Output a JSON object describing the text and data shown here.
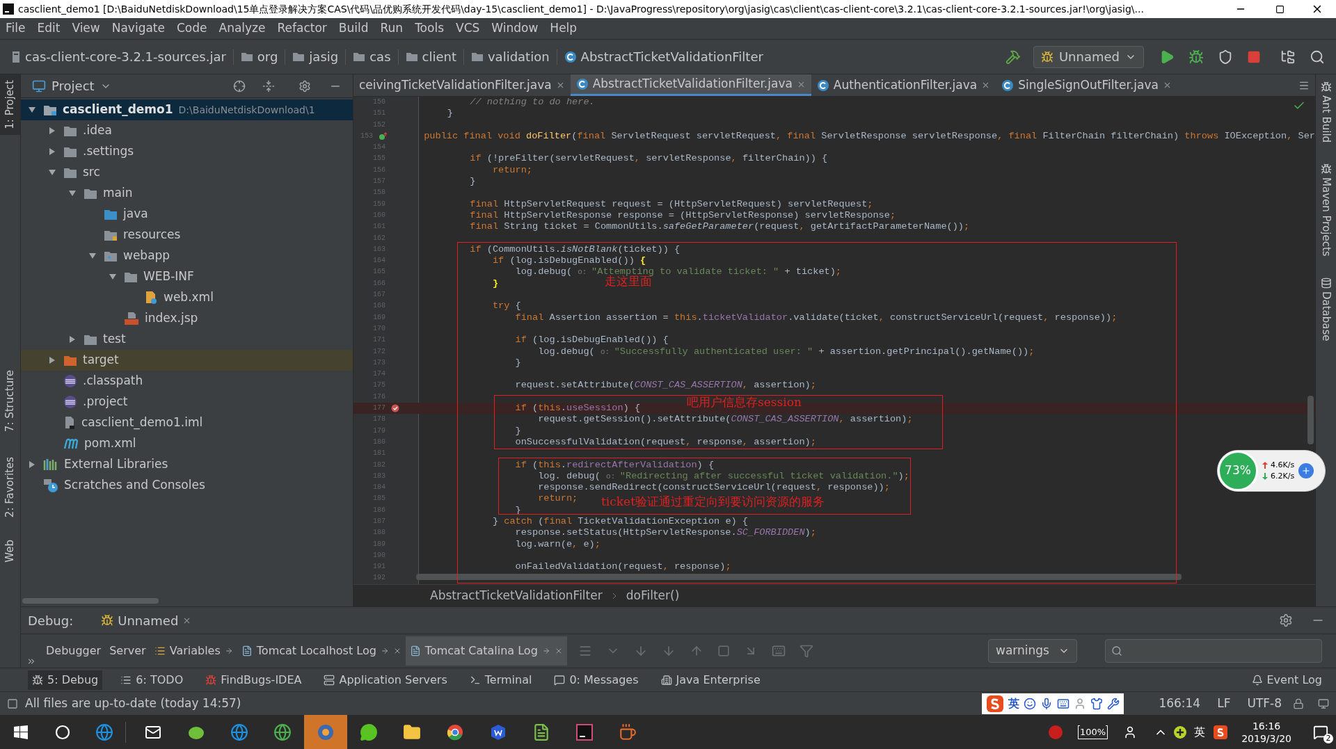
{
  "window": {
    "title": "casclient_demo1 [D:\\BaiduNetdiskDownload\\15单点登录解决方案CAS\\代码\\品优购系统开发代码\\day-15\\casclient_demo1] - D:\\JavaProgress\\repository\\org\\jasig\\cas\\client\\cas-client-core\\3.2.1\\cas-client-core-3.2.1-sources.jar!\\org\\jasig\\..."
  },
  "menu": [
    "File",
    "Edit",
    "View",
    "Navigate",
    "Code",
    "Analyze",
    "Refactor",
    "Build",
    "Run",
    "Tools",
    "VCS",
    "Window",
    "Help"
  ],
  "navbar": {
    "crumbs": [
      {
        "label": "cas-client-core-3.2.1-sources.jar",
        "kind": "jar"
      },
      {
        "label": "org",
        "kind": "folder"
      },
      {
        "label": "jasig",
        "kind": "folder"
      },
      {
        "label": "cas",
        "kind": "folder"
      },
      {
        "label": "client",
        "kind": "folder"
      },
      {
        "label": "validation",
        "kind": "folder"
      },
      {
        "label": "AbstractTicketValidationFilter",
        "kind": "class"
      }
    ],
    "run_config": "Unnamed"
  },
  "left_strip": [
    {
      "label": "1: Project",
      "selected": true
    },
    {
      "label": "7: Structure",
      "selected": false
    },
    {
      "label": "2: Favorites",
      "selected": false
    },
    {
      "label": "Web",
      "selected": false
    }
  ],
  "right_strip": [
    "Ant Build",
    "Maven Projects",
    "Database"
  ],
  "project": {
    "title": "Project",
    "tree": [
      {
        "label": "casclient_demo1",
        "path": "D:\\BaiduNetdiskDownload\\1",
        "kind": "module",
        "expanded": true,
        "selected": true,
        "highlighted": false,
        "children": [
          {
            "label": ".idea",
            "kind": "folder",
            "expanded": false,
            "selected": false,
            "highlighted": false
          },
          {
            "label": ".settings",
            "kind": "folder",
            "expanded": false,
            "selected": false,
            "highlighted": false
          },
          {
            "label": "src",
            "kind": "folder",
            "expanded": true,
            "selected": false,
            "highlighted": false,
            "children": [
              {
                "label": "main",
                "kind": "folder",
                "expanded": true,
                "selected": false,
                "highlighted": false,
                "children": [
                  {
                    "label": "java",
                    "kind": "source",
                    "selected": false,
                    "highlighted": false
                  },
                  {
                    "label": "resources",
                    "kind": "resources",
                    "selected": false,
                    "highlighted": false
                  },
                  {
                    "label": "webapp",
                    "kind": "web",
                    "expanded": true,
                    "selected": false,
                    "highlighted": false,
                    "children": [
                      {
                        "label": "WEB-INF",
                        "kind": "folder",
                        "expanded": true,
                        "selected": false,
                        "highlighted": false,
                        "children": [
                          {
                            "label": "web.xml",
                            "kind": "xml",
                            "selected": false,
                            "highlighted": false
                          }
                        ]
                      },
                      {
                        "label": "index.jsp",
                        "kind": "jsp",
                        "selected": false,
                        "highlighted": false
                      }
                    ]
                  }
                ]
              },
              {
                "label": "test",
                "kind": "folder",
                "expanded": false,
                "selected": false,
                "highlighted": false
              }
            ]
          },
          {
            "label": "target",
            "kind": "excluded",
            "expanded": false,
            "selected": false,
            "highlighted": true
          },
          {
            "label": ".classpath",
            "kind": "eclipse",
            "selected": false,
            "highlighted": false
          },
          {
            "label": ".project",
            "kind": "eclipse",
            "selected": false,
            "highlighted": false
          },
          {
            "label": "casclient_demo1.iml",
            "kind": "iml",
            "selected": false,
            "highlighted": false
          },
          {
            "label": "pom.xml",
            "kind": "maven",
            "selected": false,
            "highlighted": false
          }
        ]
      },
      {
        "label": "External Libraries",
        "kind": "libraries",
        "expanded": false,
        "selected": false,
        "highlighted": false
      },
      {
        "label": "Scratches and Consoles",
        "kind": "scratches",
        "selected": false,
        "highlighted": false
      }
    ]
  },
  "editor": {
    "tabs": [
      {
        "label": "ceivingTicketValidationFilter.java",
        "selected": false
      },
      {
        "label": "AbstractTicketValidationFilter.java",
        "selected": true
      },
      {
        "label": "AuthenticationFilter.java",
        "selected": false
      },
      {
        "label": "SingleSignOutFilter.java",
        "selected": false
      }
    ],
    "lines": [
      {
        "number": "150",
        "kind": "plain",
        "code": [
          {
            "kind": "comment",
            "text": "        // nothing to do here."
          }
        ]
      },
      {
        "number": "151",
        "kind": "plain",
        "code": [
          {
            "kind": "plain",
            "text": "    }"
          }
        ]
      },
      {
        "number": "152",
        "kind": "plain"
      },
      {
        "number": "153",
        "kind": "override",
        "code": [
          {
            "kind": "keyword",
            "text": "    public final void "
          },
          {
            "kind": "method",
            "text": "doFilter"
          },
          {
            "kind": "plain",
            "text": "("
          },
          {
            "kind": "keyword",
            "text": "final "
          },
          {
            "kind": "plain",
            "text": "ServletRequest servletRequest"
          },
          {
            "kind": "keyword",
            "text": ", final "
          },
          {
            "kind": "plain",
            "text": "ServletResponse servletResponse"
          },
          {
            "kind": "keyword",
            "text": ", final "
          },
          {
            "kind": "plain",
            "text": "FilterChain filterChain) "
          },
          {
            "kind": "keyword",
            "text": "throws "
          },
          {
            "kind": "plain",
            "text": "IOException"
          },
          {
            "kind": "keyword",
            "text": ", "
          },
          {
            "kind": "plain",
            "text": "Ser"
          }
        ]
      },
      {
        "number": "154",
        "kind": "plain"
      },
      {
        "number": "155",
        "kind": "plain",
        "code": [
          {
            "kind": "keyword",
            "text": "        if "
          },
          {
            "kind": "plain",
            "text": "(!preFilter(servletRequest"
          },
          {
            "kind": "keyword",
            "text": ", "
          },
          {
            "kind": "plain",
            "text": "servletResponse"
          },
          {
            "kind": "keyword",
            "text": ", "
          },
          {
            "kind": "plain",
            "text": "filterChain)) {"
          }
        ]
      },
      {
        "number": "156",
        "kind": "plain",
        "code": [
          {
            "kind": "keyword",
            "text": "            return;"
          }
        ]
      },
      {
        "number": "157",
        "kind": "plain",
        "code": [
          {
            "kind": "plain",
            "text": "        }"
          }
        ]
      },
      {
        "number": "158",
        "kind": "plain"
      },
      {
        "number": "159",
        "kind": "plain",
        "code": [
          {
            "kind": "keyword",
            "text": "        final "
          },
          {
            "kind": "plain",
            "text": "HttpServletRequest request = (HttpServletRequest) servletRequest"
          },
          {
            "kind": "keyword",
            "text": ";"
          }
        ]
      },
      {
        "number": "160",
        "kind": "plain",
        "code": [
          {
            "kind": "keyword",
            "text": "        final "
          },
          {
            "kind": "plain",
            "text": "HttpServletResponse response = (HttpServletResponse) servletResponse"
          },
          {
            "kind": "keyword",
            "text": ";"
          }
        ]
      },
      {
        "number": "161",
        "kind": "plain",
        "code": [
          {
            "kind": "keyword",
            "text": "        final "
          },
          {
            "kind": "plain",
            "text": "String ticket = CommonUtils."
          },
          {
            "kind": "static",
            "text": "safeGetParameter"
          },
          {
            "kind": "plain",
            "text": "(request"
          },
          {
            "kind": "keyword",
            "text": ", "
          },
          {
            "kind": "plain",
            "text": "getArtifactParameterName())"
          },
          {
            "kind": "keyword",
            "text": ";"
          }
        ]
      },
      {
        "number": "162",
        "kind": "plain"
      },
      {
        "number": "163",
        "kind": "plain",
        "code": [
          {
            "kind": "keyword",
            "text": "        if "
          },
          {
            "kind": "plain",
            "text": "(CommonUtils."
          },
          {
            "kind": "static",
            "text": "isNotBlank"
          },
          {
            "kind": "plain",
            "text": "(ticket)) {"
          }
        ]
      },
      {
        "number": "164",
        "kind": "plain",
        "code": [
          {
            "kind": "keyword",
            "text": "            if "
          },
          {
            "kind": "plain",
            "text": "(log.isDebugEnabled()) "
          },
          {
            "kind": "brace",
            "text": "{"
          }
        ]
      },
      {
        "number": "165",
        "kind": "plain",
        "code": [
          {
            "kind": "plain",
            "text": "                log.debug( "
          },
          {
            "kind": "hint",
            "text": "o: "
          },
          {
            "kind": "string",
            "text": "\"Attempting to validate ticket: \""
          },
          {
            "kind": "plain",
            "text": " + ticket)"
          },
          {
            "kind": "keyword",
            "text": ";"
          }
        ]
      },
      {
        "number": "166",
        "kind": "plain",
        "code": [
          {
            "kind": "brace",
            "text": "            }"
          }
        ]
      },
      {
        "number": "167",
        "kind": "plain"
      },
      {
        "number": "168",
        "kind": "plain",
        "code": [
          {
            "kind": "keyword",
            "text": "            try "
          },
          {
            "kind": "plain",
            "text": "{"
          }
        ]
      },
      {
        "number": "169",
        "kind": "plain",
        "code": [
          {
            "kind": "keyword",
            "text": "                final "
          },
          {
            "kind": "plain",
            "text": "Assertion assertion = "
          },
          {
            "kind": "keyword",
            "text": "this"
          },
          {
            "kind": "plain",
            "text": "."
          },
          {
            "kind": "field",
            "text": "ticketValidator"
          },
          {
            "kind": "plain",
            "text": ".validate(ticket"
          },
          {
            "kind": "keyword",
            "text": ", "
          },
          {
            "kind": "plain",
            "text": "constructServiceUrl(request"
          },
          {
            "kind": "keyword",
            "text": ", "
          },
          {
            "kind": "plain",
            "text": "response))"
          },
          {
            "kind": "keyword",
            "text": ";"
          }
        ]
      },
      {
        "number": "170",
        "kind": "plain"
      },
      {
        "number": "171",
        "kind": "plain",
        "code": [
          {
            "kind": "keyword",
            "text": "                if "
          },
          {
            "kind": "plain",
            "text": "(log.isDebugEnabled()) {"
          }
        ]
      },
      {
        "number": "172",
        "kind": "plain",
        "code": [
          {
            "kind": "plain",
            "text": "                    log.debug( "
          },
          {
            "kind": "hint",
            "text": "o: "
          },
          {
            "kind": "string",
            "text": "\"Successfully authenticated user: \""
          },
          {
            "kind": "plain",
            "text": " + assertion.getPrincipal().getName())"
          },
          {
            "kind": "keyword",
            "text": ";"
          }
        ]
      },
      {
        "number": "173",
        "kind": "plain",
        "code": [
          {
            "kind": "plain",
            "text": "                }"
          }
        ]
      },
      {
        "number": "174",
        "kind": "plain"
      },
      {
        "number": "175",
        "kind": "plain",
        "code": [
          {
            "kind": "plain",
            "text": "                request.setAttribute("
          },
          {
            "kind": "constant",
            "text": "CONST_CAS_ASSERTION"
          },
          {
            "kind": "keyword",
            "text": ", "
          },
          {
            "kind": "plain",
            "text": "assertion)"
          },
          {
            "kind": "keyword",
            "text": ";"
          }
        ]
      },
      {
        "number": "176",
        "kind": "plain"
      },
      {
        "number": "177",
        "kind": "breakpoint",
        "code": [
          {
            "kind": "keyword",
            "text": "                if "
          },
          {
            "kind": "plain",
            "text": "("
          },
          {
            "kind": "keyword",
            "text": "this"
          },
          {
            "kind": "plain",
            "text": "."
          },
          {
            "kind": "field",
            "text": "useSession"
          },
          {
            "kind": "plain",
            "text": ") {"
          }
        ]
      },
      {
        "number": "178",
        "kind": "plain",
        "code": [
          {
            "kind": "plain",
            "text": "                    request.getSession().setAttribute("
          },
          {
            "kind": "constant",
            "text": "CONST_CAS_ASSERTION"
          },
          {
            "kind": "keyword",
            "text": ", "
          },
          {
            "kind": "plain",
            "text": "assertion)"
          },
          {
            "kind": "keyword",
            "text": ";"
          }
        ]
      },
      {
        "number": "179",
        "kind": "plain",
        "code": [
          {
            "kind": "plain",
            "text": "                }"
          }
        ]
      },
      {
        "number": "180",
        "kind": "plain",
        "code": [
          {
            "kind": "plain",
            "text": "                onSuccessfulValidation(request"
          },
          {
            "kind": "keyword",
            "text": ", "
          },
          {
            "kind": "plain",
            "text": "response"
          },
          {
            "kind": "keyword",
            "text": ", "
          },
          {
            "kind": "plain",
            "text": "assertion)"
          },
          {
            "kind": "keyword",
            "text": ";"
          }
        ]
      },
      {
        "number": "181",
        "kind": "plain"
      },
      {
        "number": "182",
        "kind": "plain",
        "code": [
          {
            "kind": "keyword",
            "text": "                if "
          },
          {
            "kind": "plain",
            "text": "("
          },
          {
            "kind": "keyword",
            "text": "this"
          },
          {
            "kind": "plain",
            "text": "."
          },
          {
            "kind": "field",
            "text": "redirectAfterValidation"
          },
          {
            "kind": "plain",
            "text": ") {"
          }
        ]
      },
      {
        "number": "183",
        "kind": "plain",
        "code": [
          {
            "kind": "plain",
            "text": "                    log. debug( "
          },
          {
            "kind": "hint",
            "text": "o: "
          },
          {
            "kind": "string",
            "text": "\"Redirecting after successful ticket validation.\""
          },
          {
            "kind": "plain",
            "text": ")"
          },
          {
            "kind": "keyword",
            "text": ";"
          }
        ]
      },
      {
        "number": "184",
        "kind": "plain",
        "code": [
          {
            "kind": "plain",
            "text": "                    response.sendRedirect(constructServiceUrl(request"
          },
          {
            "kind": "keyword",
            "text": ", "
          },
          {
            "kind": "plain",
            "text": "response))"
          },
          {
            "kind": "keyword",
            "text": ";"
          }
        ]
      },
      {
        "number": "185",
        "kind": "plain",
        "code": [
          {
            "kind": "keyword",
            "text": "                    return;"
          }
        ]
      },
      {
        "number": "186",
        "kind": "plain",
        "code": [
          {
            "kind": "plain",
            "text": "                }"
          }
        ]
      },
      {
        "number": "187",
        "kind": "plain",
        "code": [
          {
            "kind": "plain",
            "text": "            } "
          },
          {
            "kind": "keyword",
            "text": "catch "
          },
          {
            "kind": "plain",
            "text": "("
          },
          {
            "kind": "keyword",
            "text": "final "
          },
          {
            "kind": "plain",
            "text": "TicketValidationException e) {"
          }
        ]
      },
      {
        "number": "188",
        "kind": "plain",
        "code": [
          {
            "kind": "plain",
            "text": "                response.setStatus(HttpServletResponse."
          },
          {
            "kind": "constant",
            "text": "SC_FORBIDDEN"
          },
          {
            "kind": "plain",
            "text": ")"
          },
          {
            "kind": "keyword",
            "text": ";"
          }
        ]
      },
      {
        "number": "189",
        "kind": "plain",
        "code": [
          {
            "kind": "plain",
            "text": "                log.warn(e"
          },
          {
            "kind": "keyword",
            "text": ", "
          },
          {
            "kind": "plain",
            "text": "e)"
          },
          {
            "kind": "keyword",
            "text": ";"
          }
        ]
      },
      {
        "number": "190",
        "kind": "plain"
      },
      {
        "number": "191",
        "kind": "plain",
        "code": [
          {
            "kind": "plain",
            "text": "                onFailedValidation(request"
          },
          {
            "kind": "keyword",
            "text": ", "
          },
          {
            "kind": "plain",
            "text": "response)"
          },
          {
            "kind": "keyword",
            "text": ";"
          }
        ]
      },
      {
        "number": "192",
        "kind": "plain"
      }
    ],
    "annotations": [
      "走这里面",
      "吧用户信息存session",
      "ticket验证通过重定向到要访问资源的服务"
    ],
    "breadcrumb": [
      "AbstractTicketValidationFilter",
      "doFilter()"
    ]
  },
  "net_widget": {
    "percent": "73%",
    "up": "4.6K/s",
    "down": "6.2K/s"
  },
  "debug": {
    "label": "Debug:",
    "session": "Unnamed",
    "tabs": [
      {
        "label": "Debugger",
        "kind": "plain",
        "selected": false
      },
      {
        "label": "Server",
        "kind": "plain",
        "selected": false
      },
      {
        "label": "Variables",
        "kind": "pinned",
        "selected": false
      },
      {
        "label": "Tomcat Localhost Log",
        "kind": "log",
        "selected": false
      },
      {
        "label": "Tomcat Catalina Log",
        "kind": "log",
        "selected": true
      }
    ],
    "filter": "warnings"
  },
  "tool_windows": [
    {
      "label": "5: Debug",
      "kind": "bug",
      "selected": true
    },
    {
      "label": "6: TODO",
      "kind": "list",
      "selected": false
    },
    {
      "label": "FindBugs-IDEA",
      "kind": "findbugs",
      "selected": false
    },
    {
      "label": "Application Servers",
      "kind": "server",
      "selected": false
    },
    {
      "label": "Terminal",
      "kind": "terminal",
      "selected": false
    },
    {
      "label": "0: Messages",
      "kind": "messages",
      "selected": false
    },
    {
      "label": "Java Enterprise",
      "kind": "enterprise",
      "selected": false
    }
  ],
  "event_log": "Event Log",
  "status_bar": {
    "message": "All files are up-to-date (today 14:57)",
    "ime": "英",
    "position": "166:14",
    "line_sep": "LF",
    "encoding": "UTF-8"
  },
  "taskbar": {
    "apps": [
      {
        "kind": "mail",
        "selected": false
      },
      {
        "kind": "android",
        "selected": false
      },
      {
        "kind": "browser",
        "selected": false
      },
      {
        "kind": "browser-green",
        "selected": false
      },
      {
        "kind": "media",
        "selected": true
      },
      {
        "kind": "chat",
        "selected": false
      },
      {
        "kind": "folder",
        "selected": false
      },
      {
        "kind": "chrome",
        "selected": false
      },
      {
        "kind": "doc",
        "selected": false
      },
      {
        "kind": "notepad",
        "selected": false
      },
      {
        "kind": "ide",
        "selected": false
      },
      {
        "kind": "java",
        "selected": false
      }
    ],
    "battery": "100%",
    "ime": "英",
    "time": "16:16",
    "date": "2019/3/20",
    "notifications": "2"
  }
}
